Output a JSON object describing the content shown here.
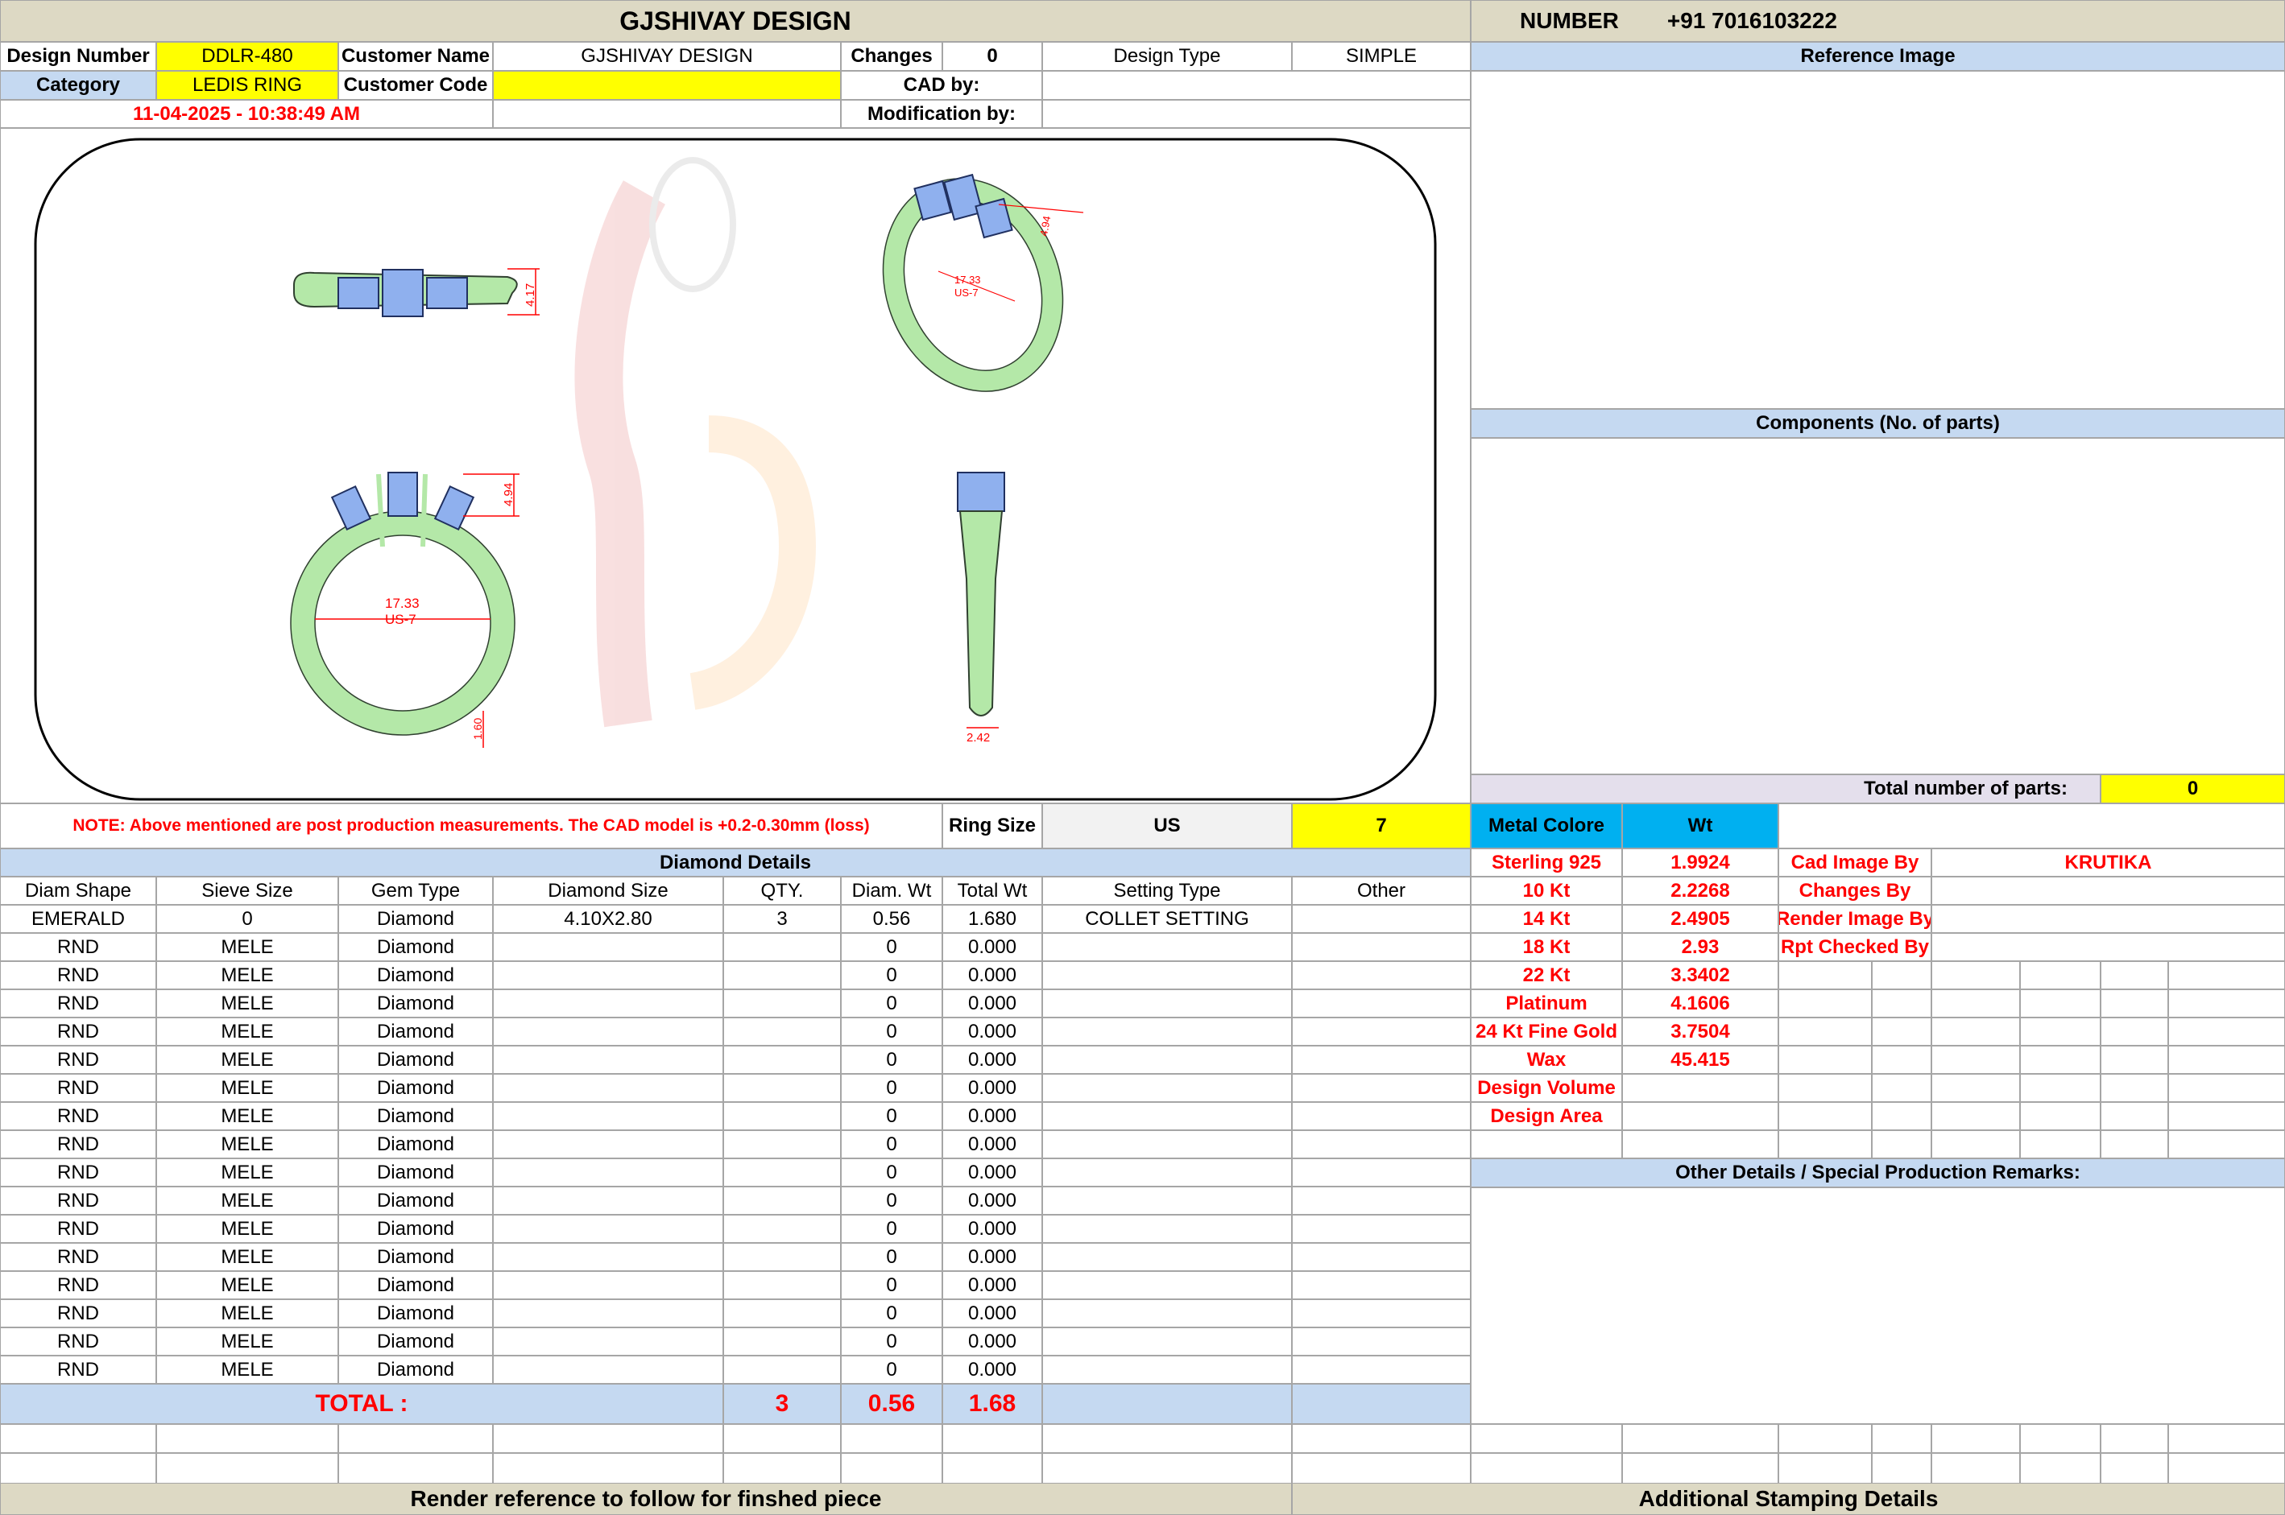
{
  "header": {
    "company": "GJSHIVAY DESIGN",
    "number_label": "NUMBER",
    "number_value": "+91 7016103222"
  },
  "info": {
    "design_number_label": "Design Number",
    "design_number": "DDLR-480",
    "customer_name_label": "Customer Name",
    "customer_name": "GJSHIVAY DESIGN",
    "changes_label": "Changes",
    "changes_value": "0",
    "design_type_label": "Design Type",
    "design_type": "SIMPLE",
    "category_label": "Category",
    "category": "LEDIS RING",
    "customer_code_label": "Customer Code",
    "customer_code": "",
    "cad_by_label": "CAD by:",
    "cad_by": "",
    "modification_by_label": "Modification by:",
    "modification_by": "",
    "datetime": "11-04-2025 - 10:38:49 AM"
  },
  "right_panel": {
    "reference_image_label": "Reference Image",
    "components_label": "Components (No. of parts)",
    "total_parts_label": "Total number of parts:",
    "total_parts_value": "0",
    "other_details_label": "Other Details / Special Production Remarks:"
  },
  "drawing": {
    "top_dim": "4.17",
    "persp_height": "4.94",
    "persp_inner": "17.33",
    "persp_us": "US-7",
    "front_height": "4.94",
    "inner_diameter": "17.33",
    "us_size": "US-7",
    "shank_bottom": "1.60",
    "side_width": "2.42"
  },
  "note": {
    "text": "NOTE: Above mentioned are post production measurements. The CAD model is +0.2-0.30mm (loss)",
    "ring_size_label": "Ring Size",
    "ring_size_unit": "US",
    "ring_size_value": "7"
  },
  "metal": {
    "header_label": "Metal Colore",
    "header_wt": "Wt",
    "rows": [
      {
        "name": "Sterling 925",
        "wt": "1.9924"
      },
      {
        "name": "10 Kt",
        "wt": "2.2268"
      },
      {
        "name": "14 Kt",
        "wt": "2.4905"
      },
      {
        "name": "18 Kt",
        "wt": "2.93"
      },
      {
        "name": "22 Kt",
        "wt": "3.3402"
      },
      {
        "name": "Platinum",
        "wt": "4.1606"
      },
      {
        "name": "24 Kt Fine Gold",
        "wt": "3.7504"
      },
      {
        "name": "Wax",
        "wt": "45.415"
      },
      {
        "name": "Design Volume",
        "wt": ""
      },
      {
        "name": "Design Area",
        "wt": ""
      }
    ]
  },
  "credits": [
    {
      "label": "Cad Image By",
      "value": "KRUTIKA"
    },
    {
      "label": "Changes By",
      "value": ""
    },
    {
      "label": "Render Image By",
      "value": ""
    },
    {
      "label": "Rpt Checked By",
      "value": ""
    }
  ],
  "diamond": {
    "title": "Diamond Details",
    "columns": [
      "Diam Shape",
      "Sieve Size",
      "Gem Type",
      "Diamond Size",
      "QTY.",
      "Diam. Wt",
      "Total Wt",
      "Setting Type",
      "Other"
    ],
    "rows": [
      [
        "EMERALD",
        "0",
        "Diamond",
        "4.10X2.80",
        "3",
        "0.56",
        "1.680",
        "COLLET SETTING",
        ""
      ],
      [
        "RND",
        "MELE",
        "Diamond",
        "",
        "",
        "0",
        "0.000",
        "",
        ""
      ],
      [
        "RND",
        "MELE",
        "Diamond",
        "",
        "",
        "0",
        "0.000",
        "",
        ""
      ],
      [
        "RND",
        "MELE",
        "Diamond",
        "",
        "",
        "0",
        "0.000",
        "",
        ""
      ],
      [
        "RND",
        "MELE",
        "Diamond",
        "",
        "",
        "0",
        "0.000",
        "",
        ""
      ],
      [
        "RND",
        "MELE",
        "Diamond",
        "",
        "",
        "0",
        "0.000",
        "",
        ""
      ],
      [
        "RND",
        "MELE",
        "Diamond",
        "",
        "",
        "0",
        "0.000",
        "",
        ""
      ],
      [
        "RND",
        "MELE",
        "Diamond",
        "",
        "",
        "0",
        "0.000",
        "",
        ""
      ],
      [
        "RND",
        "MELE",
        "Diamond",
        "",
        "",
        "0",
        "0.000",
        "",
        ""
      ],
      [
        "RND",
        "MELE",
        "Diamond",
        "",
        "",
        "0",
        "0.000",
        "",
        ""
      ],
      [
        "RND",
        "MELE",
        "Diamond",
        "",
        "",
        "0",
        "0.000",
        "",
        ""
      ],
      [
        "RND",
        "MELE",
        "Diamond",
        "",
        "",
        "0",
        "0.000",
        "",
        ""
      ],
      [
        "RND",
        "MELE",
        "Diamond",
        "",
        "",
        "0",
        "0.000",
        "",
        ""
      ],
      [
        "RND",
        "MELE",
        "Diamond",
        "",
        "",
        "0",
        "0.000",
        "",
        ""
      ],
      [
        "RND",
        "MELE",
        "Diamond",
        "",
        "",
        "0",
        "0.000",
        "",
        ""
      ],
      [
        "RND",
        "MELE",
        "Diamond",
        "",
        "",
        "0",
        "0.000",
        "",
        ""
      ],
      [
        "RND",
        "MELE",
        "Diamond",
        "",
        "",
        "0",
        "0.000",
        "",
        ""
      ]
    ],
    "total_label": "TOTAL :",
    "total_qty": "3",
    "total_diam_wt": "0.56",
    "total_wt": "1.68"
  },
  "footer": {
    "render_label": "Render reference to follow for finshed piece",
    "stamping_label": "Additional Stamping Details"
  },
  "colors": {
    "metal_green": "#b4e8a8",
    "stone_blue": "#8fb0ee",
    "dimension_red": "#ff0000",
    "header_beige": "#ddd9c4",
    "section_blue": "#c5d9f1",
    "highlight_yellow": "#ffff00",
    "metal_header_cyan": "#00b0f0"
  }
}
